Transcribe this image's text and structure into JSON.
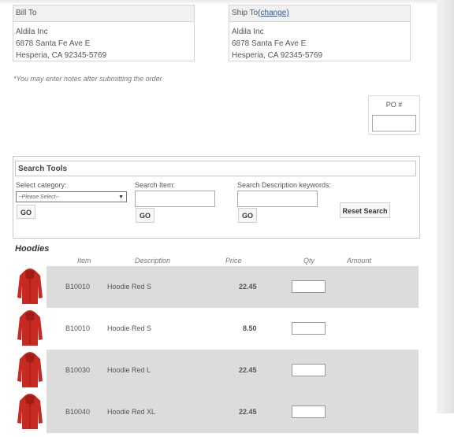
{
  "bill_to": {
    "heading": "Bill To",
    "lines": [
      "Aldila Inc",
      "6878 Santa Fe Ave E",
      "Hesperia, CA 92345-5769"
    ]
  },
  "ship_to": {
    "heading": "Ship To",
    "change_link": "(change)",
    "lines": [
      "Aldila Inc",
      "6878 Santa Fe Ave E",
      "Hesperia, CA 92345-5769"
    ]
  },
  "notes_hint": "*You may enter notes after submitting the order",
  "po": {
    "label": "PO #",
    "value": ""
  },
  "search_tools": {
    "title": "Search Tools",
    "category_label": "Select category:",
    "category_selected": "--Please Select--",
    "item_label": "Search Item:",
    "desc_label": "Search Description keywords:",
    "go_label": "GO",
    "reset_label": "Reset Search"
  },
  "products": {
    "section_title": "Hoodies",
    "columns": {
      "item": "Item",
      "description": "Description",
      "price": "Price",
      "qty": "Qty",
      "amount": "Amount"
    },
    "rows": [
      {
        "item": "B10010",
        "description": "Hoodie Red S",
        "price": "22.45"
      },
      {
        "item": "B10010",
        "description": "Hoodie Red S",
        "price": "8.50"
      },
      {
        "item": "B10030",
        "description": "Hoodie Red L",
        "price": "22.45"
      },
      {
        "item": "B10040",
        "description": "Hoodie Red XL",
        "price": "22.45"
      }
    ],
    "image_color": "#c62a22"
  }
}
